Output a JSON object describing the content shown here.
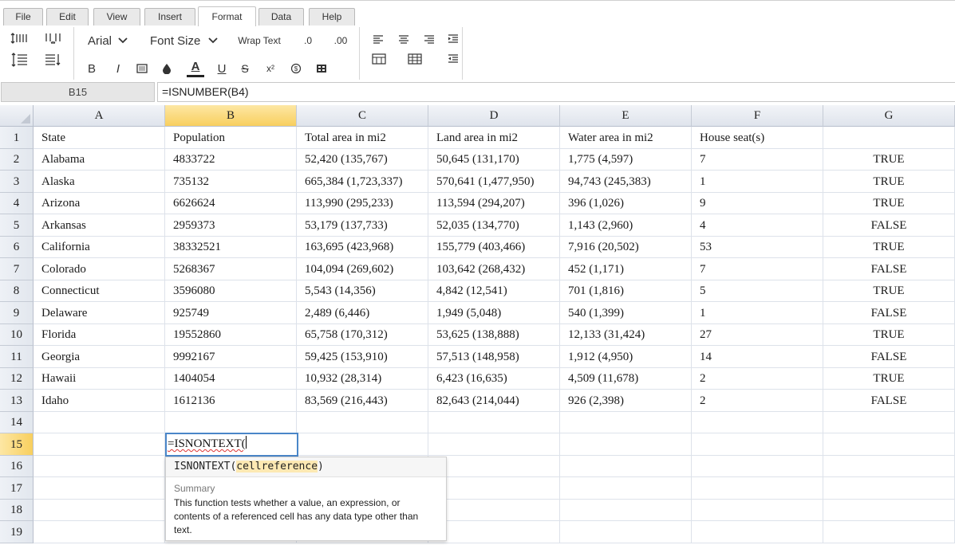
{
  "tabs": [
    {
      "label": "File",
      "active": false
    },
    {
      "label": "Edit",
      "active": false
    },
    {
      "label": "View",
      "active": false
    },
    {
      "label": "Insert",
      "active": false
    },
    {
      "label": "Format",
      "active": true
    },
    {
      "label": "Data",
      "active": false
    },
    {
      "label": "Help",
      "active": false
    }
  ],
  "toolbar": {
    "font_name": "Arial",
    "font_size": "Font Size",
    "wrap_text": "Wrap Text",
    "decimal_decrease": ".0",
    "decimal_increase": ".00",
    "bold": "B",
    "italic": "I",
    "text_color_glyph": "A",
    "underline": "U",
    "strike": "S",
    "superscript": "x²",
    "accent_color": "#222222"
  },
  "formula_bar": {
    "cell_ref": "B15",
    "formula": "=ISNUMBER(B4)"
  },
  "grid": {
    "columns": [
      "A",
      "B",
      "C",
      "D",
      "E",
      "F",
      "G"
    ],
    "selected_column": "B",
    "selected_row": "15",
    "rows": [
      {
        "num": "1",
        "cells": [
          "State",
          "Population",
          "Total area in mi2",
          "Land area in mi2",
          "Water area in mi2",
          "House seat(s)",
          ""
        ]
      },
      {
        "num": "2",
        "cells": [
          "Alabama",
          "4833722",
          "52,420 (135,767)",
          "50,645 (131,170)",
          "1,775 (4,597)",
          "7",
          "TRUE"
        ]
      },
      {
        "num": "3",
        "cells": [
          "Alaska",
          "735132",
          "665,384 (1,723,337)",
          "570,641 (1,477,950)",
          "94,743 (245,383)",
          "1",
          "TRUE"
        ]
      },
      {
        "num": "4",
        "cells": [
          "Arizona",
          "6626624",
          "113,990 (295,233)",
          "113,594 (294,207)",
          "396 (1,026)",
          "9",
          "TRUE"
        ]
      },
      {
        "num": "5",
        "cells": [
          "Arkansas",
          "2959373",
          "53,179 (137,733)",
          "52,035 (134,770)",
          "1,143 (2,960)",
          "4",
          "FALSE"
        ]
      },
      {
        "num": "6",
        "cells": [
          "California",
          "38332521",
          "163,695 (423,968)",
          "155,779 (403,466)",
          "7,916 (20,502)",
          "53",
          "TRUE"
        ]
      },
      {
        "num": "7",
        "cells": [
          "Colorado",
          "5268367",
          "104,094 (269,602)",
          "103,642 (268,432)",
          "452 (1,171)",
          "7",
          "FALSE"
        ]
      },
      {
        "num": "8",
        "cells": [
          "Connecticut",
          "3596080",
          "5,543 (14,356)",
          "4,842 (12,541)",
          "701 (1,816)",
          "5",
          "TRUE"
        ]
      },
      {
        "num": "9",
        "cells": [
          "Delaware",
          "925749",
          "2,489 (6,446)",
          "1,949 (5,048)",
          "540 (1,399)",
          "1",
          "FALSE"
        ]
      },
      {
        "num": "10",
        "cells": [
          "Florida",
          "19552860",
          "65,758 (170,312)",
          "53,625 (138,888)",
          "12,133 (31,424)",
          "27",
          "TRUE"
        ]
      },
      {
        "num": "11",
        "cells": [
          "Georgia",
          "9992167",
          "59,425 (153,910)",
          "57,513 (148,958)",
          "1,912 (4,950)",
          "14",
          "FALSE"
        ]
      },
      {
        "num": "12",
        "cells": [
          "Hawaii",
          "1404054",
          "10,932 (28,314)",
          "6,423 (16,635)",
          "4,509 (11,678)",
          "2",
          "TRUE"
        ]
      },
      {
        "num": "13",
        "cells": [
          "Idaho",
          "1612136",
          "83,569 (216,443)",
          "82,643 (214,044)",
          "926 (2,398)",
          "2",
          "FALSE"
        ]
      },
      {
        "num": "14",
        "cells": [
          "",
          "",
          "",
          "",
          "",
          "",
          ""
        ]
      },
      {
        "num": "15",
        "cells": [
          "",
          "",
          "",
          "",
          "",
          "",
          ""
        ]
      },
      {
        "num": "16",
        "cells": [
          "",
          "",
          "",
          "",
          "",
          "",
          ""
        ]
      },
      {
        "num": "17",
        "cells": [
          "",
          "",
          "",
          "",
          "",
          "",
          ""
        ]
      },
      {
        "num": "18",
        "cells": [
          "",
          "",
          "",
          "",
          "",
          "",
          ""
        ]
      },
      {
        "num": "19",
        "cells": [
          "",
          "",
          "",
          "",
          "",
          "",
          ""
        ]
      }
    ]
  },
  "editor": {
    "text": "=ISNONTEXT("
  },
  "autocomplete": {
    "fn_name": "ISNONTEXT(",
    "fn_arg": "cellreference",
    "fn_close": ")",
    "summary_label": "Summary",
    "description": "This function tests whether a value, an expression, or contents of a referenced cell has any data type other than text."
  }
}
